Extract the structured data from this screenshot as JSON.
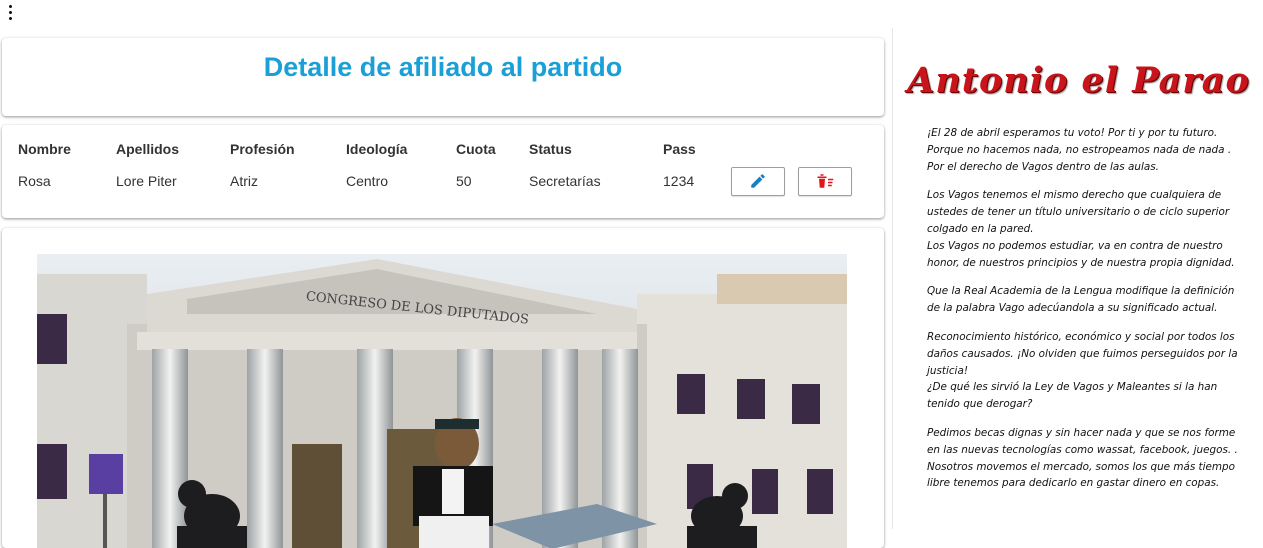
{
  "app": {
    "menu_icon": "more-vertical-icon"
  },
  "header": {
    "title": "Detalle de afiliado al partido"
  },
  "table": {
    "columns": [
      "Nombre",
      "Apellidos",
      "Profesión",
      "Ideología",
      "Cuota",
      "Status",
      "Pass"
    ],
    "rows": [
      {
        "nombre": "Rosa",
        "apellidos": "Lore Piter",
        "profesion": "Atriz",
        "ideologia": "Centro",
        "cuota": "50",
        "status": "Secretarías",
        "pass": "1234"
      }
    ],
    "actions": {
      "edit_icon": "pencil-icon",
      "delete_icon": "trash-list-icon"
    },
    "colors": {
      "edit": "#1a7fc1",
      "delete": "#e8121b"
    }
  },
  "image": {
    "building_sign": "CONGRESO DE LOS DIPUTADOS"
  },
  "sidebar": {
    "brand": "Antonio el Parao",
    "paragraphs": [
      "¡El 28 de abril esperamos tu voto! Por ti y por tu futuro.\nPorque no hacemos nada, no estropeamos nada de nada .\nPor el derecho de Vagos dentro de las aulas.",
      "Los Vagos tenemos el mismo derecho que cualquiera de\nustedes de tener un título universitario o de ciclo superior\ncolgado en la pared.\nLos Vagos no podemos estudiar, va en contra de nuestro\nhonor, de nuestros principios y de nuestra propia dignidad.",
      "Que la Real Academia de la Lengua modifique la definición\nde la palabra Vago adecúandola a su significado actual.",
      "Reconocimiento histórico, económico y social por todos los\ndaños causados. ¡No olviden que fuimos perseguidos por la\njusticia!\n¿De qué les sirvió la Ley de Vagos y Maleantes si la han\ntenido que derogar?",
      "Pedimos becas dignas y sin hacer nada y que se nos forme\nen las nuevas tecnologías como wassat, facebook, juegos. .\nNosotros movemos el mercado, somos los que más tiempo\nlibre tenemos para dedicarlo en gastar dinero en copas."
    ]
  }
}
